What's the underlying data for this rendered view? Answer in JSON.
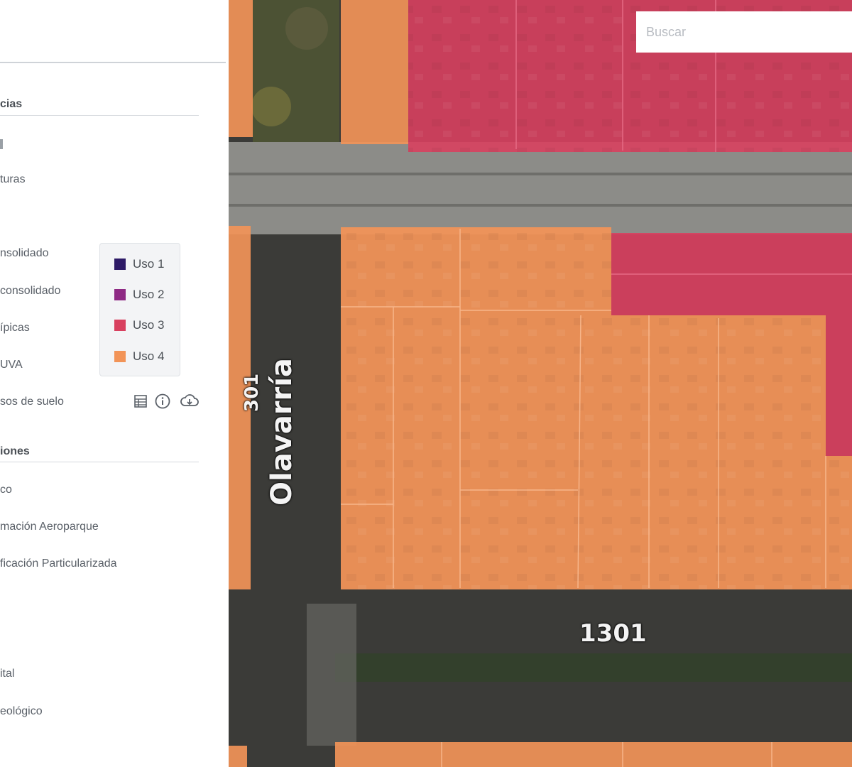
{
  "sidebar": {
    "section_1_heading": "cias",
    "section_1_items": [
      "l",
      "turas",
      "nsolidado",
      "consolidado",
      "ípicas",
      "UVA",
      "sos de suelo"
    ],
    "section_2_heading": "iones",
    "section_2_items": [
      "co",
      "mación Aeroparque",
      "ficación Particularizada",
      "ital",
      "eológico"
    ]
  },
  "legend": {
    "items": [
      {
        "label": "Uso 1",
        "color": "#2d1a66"
      },
      {
        "label": "Uso 2",
        "color": "#8e2a84"
      },
      {
        "label": "Uso 3",
        "color": "#d8405f"
      },
      {
        "label": "Uso 4",
        "color": "#f29458"
      }
    ]
  },
  "layer_tools": {
    "icons": [
      "table-icon",
      "info-icon",
      "cloud-download-icon"
    ]
  },
  "map": {
    "search_placeholder": "Buscar",
    "street_name": "Olavarría",
    "street_number_vertical": "301",
    "street_number_horizontal": "1301",
    "colors": {
      "uso3": "#d8405f",
      "uso4": "#f29458",
      "road": "#8c8c88",
      "asphalt": "#3b3b38"
    }
  }
}
